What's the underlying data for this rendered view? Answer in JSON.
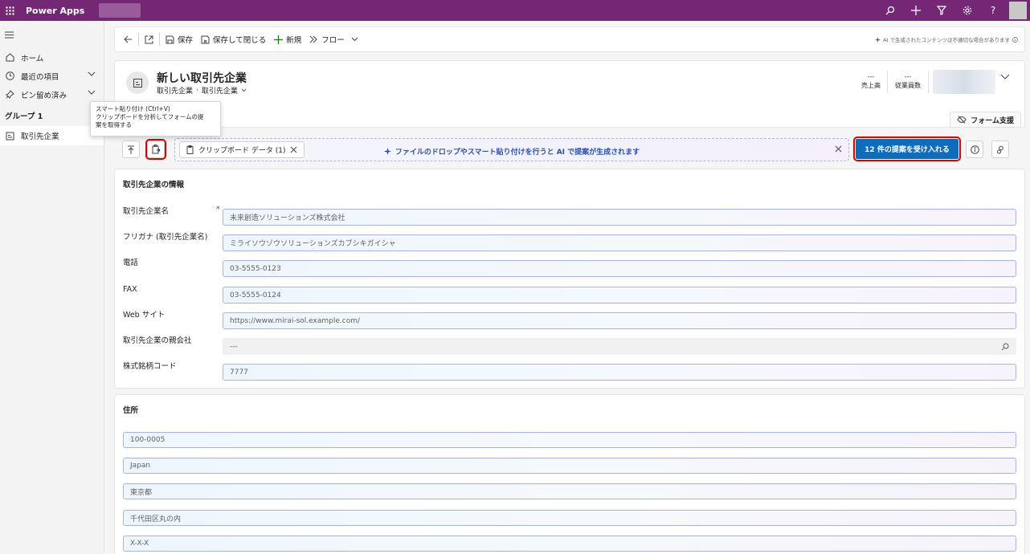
{
  "topbar": {
    "app_name": "Power Apps"
  },
  "sidebar": {
    "items": [
      {
        "label": "ホーム"
      },
      {
        "label": "最近の項目"
      },
      {
        "label": "ピン留め済み"
      }
    ],
    "group_label": "グループ 1",
    "active_item": "取引先企業"
  },
  "tooltip": {
    "line1": "スマート貼り付け (Ctrl+V)",
    "line2": "クリップボードを分析してフォームの提",
    "line3": "案を取得する"
  },
  "commandbar": {
    "save": "保存",
    "save_close": "保存して閉じる",
    "new": "新規",
    "flow": "フロー",
    "ai_disclaimer": "AI で生成されたコンテンツは不適切な場合があります"
  },
  "header": {
    "title": "新しい取引先企業",
    "entity": "取引先企業",
    "form_name": "取引先企業",
    "kpis": [
      {
        "value": "---",
        "label": "売上高"
      },
      {
        "value": "---",
        "label": "従業員数"
      }
    ],
    "form_assist": "フォーム支援"
  },
  "ai_bar": {
    "chip_label": "クリップボード データ (1)",
    "drop_text": "ファイルのドロップやスマート貼り付けを行うと AI で提案が生成されます",
    "accept_button": "12 件の提案を受け入れる"
  },
  "account_section": {
    "title": "取引先企業の情報",
    "fields": [
      {
        "label": "取引先企業名",
        "value": "未来創造ソリューションズ株式会社"
      },
      {
        "label": "フリガナ (取引先企業名)",
        "value": "ミライソウゾウソリューションズカブシキガイシャ"
      },
      {
        "label": "電話",
        "value": "03-5555-0123"
      },
      {
        "label": "FAX",
        "value": "03-5555-0124"
      },
      {
        "label": "Web サイト",
        "value": "https://www.mirai-sol.example.com/"
      },
      {
        "label": "取引先企業の親会社",
        "value": "---"
      },
      {
        "label": "株式銘柄コード",
        "value": "7777"
      }
    ]
  },
  "address_section": {
    "title": "住所",
    "fields": [
      "100-0005",
      "Japan",
      "東京都",
      "千代田区丸の内",
      "X-X-X"
    ]
  }
}
